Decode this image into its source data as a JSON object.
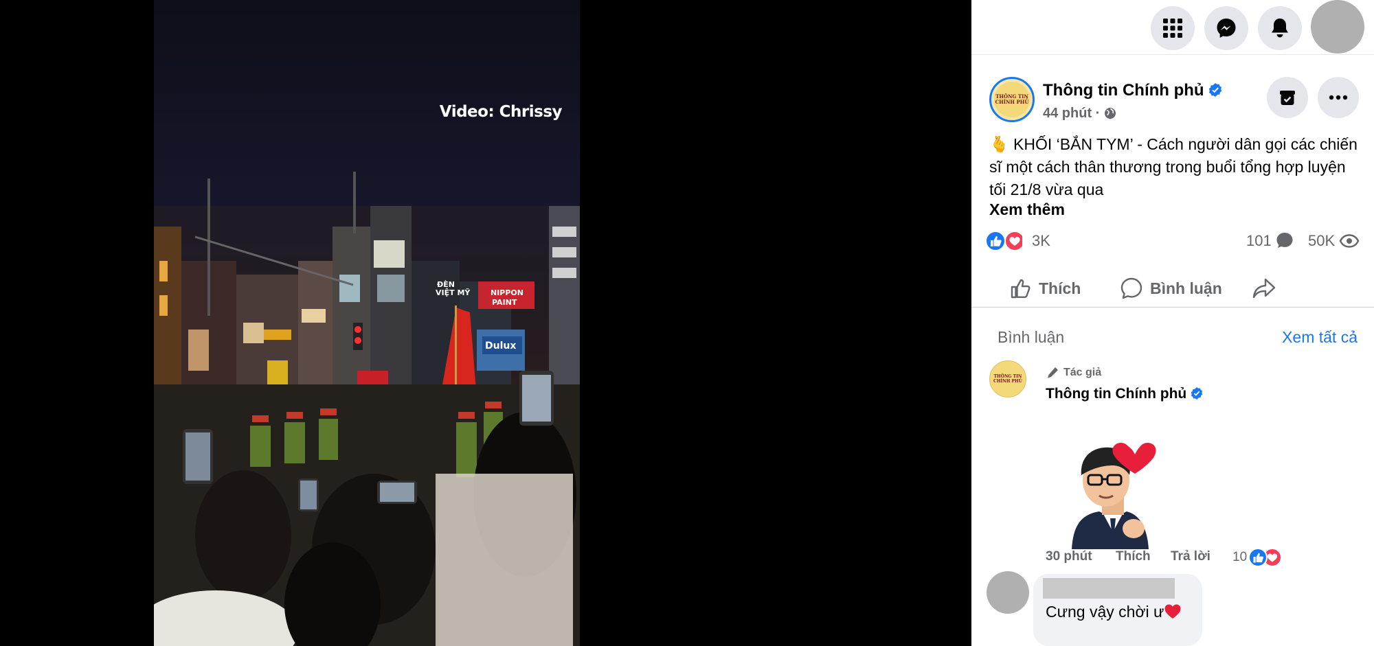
{
  "video": {
    "watermark": "Video: Chrissy"
  },
  "topbar": {
    "icons": [
      "apps-grid-icon",
      "messenger-icon",
      "notifications-bell-icon",
      "profile-avatar"
    ]
  },
  "post": {
    "page_name": "Thông tin Chính phủ",
    "time": "44 phút",
    "privacy_separator": " · ",
    "text_emoji": "🫰",
    "text": " KHỐI ‘BẮN TYM’ - Cách người dân gọi các chiến sĩ một cách thân thương trong buổi tổng hợp luyện tối 21/8 vừa qua",
    "see_more": "Xem thêm",
    "reactions_count": "3K",
    "comments_count": "101",
    "views_count": "50K"
  },
  "actions": {
    "like": "Thích",
    "comment": "Bình luận"
  },
  "comments_section": {
    "heading": "Bình luận",
    "see_all": "Xem tất cả",
    "comment1": {
      "author_tag": "Tác giả",
      "name": "Thông tin Chính phủ",
      "time": "30 phút",
      "like": "Thích",
      "reply": "Trả lời",
      "reactions": "10"
    },
    "comment2": {
      "text": "Cưng vậy chời ư"
    }
  },
  "colors": {
    "accent": "#1877f2",
    "like_blue": "#1877f2",
    "love_red": "#f33e58",
    "muted_text": "#65676b"
  }
}
